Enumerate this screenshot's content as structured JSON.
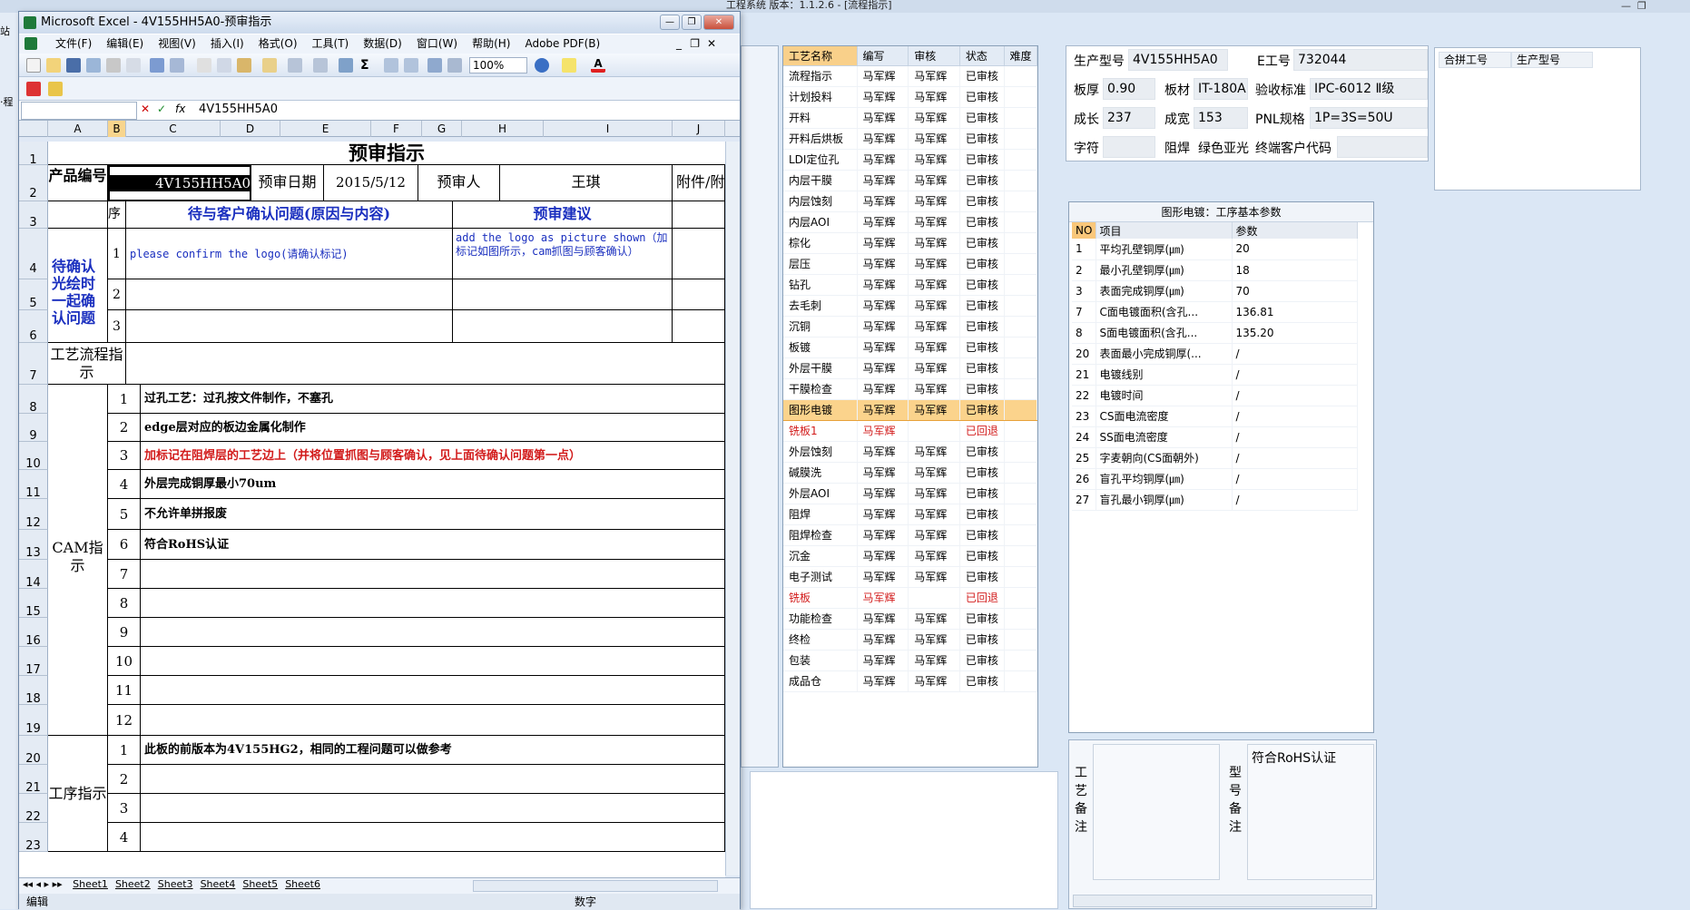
{
  "bg_app": {
    "title": "工程系统  版本：1.1.2.6 - [流程指示]",
    "left_labels": [
      "站",
      "·程"
    ]
  },
  "process_table": {
    "headers": [
      "工艺名称",
      "编写",
      "审核",
      "状态",
      "难度"
    ],
    "rows": [
      [
        "流程指示",
        "马军辉",
        "马军辉",
        "已审核",
        ""
      ],
      [
        "计划投料",
        "马军辉",
        "马军辉",
        "已审核",
        ""
      ],
      [
        "开料",
        "马军辉",
        "马军辉",
        "已审核",
        ""
      ],
      [
        "开料后烘板",
        "马军辉",
        "马军辉",
        "已审核",
        ""
      ],
      [
        "LDI定位孔",
        "马军辉",
        "马军辉",
        "已审核",
        ""
      ],
      [
        "内层干膜",
        "马军辉",
        "马军辉",
        "已审核",
        ""
      ],
      [
        "内层蚀刻",
        "马军辉",
        "马军辉",
        "已审核",
        ""
      ],
      [
        "内层AOI",
        "马军辉",
        "马军辉",
        "已审核",
        ""
      ],
      [
        "棕化",
        "马军辉",
        "马军辉",
        "已审核",
        ""
      ],
      [
        "层压",
        "马军辉",
        "马军辉",
        "已审核",
        ""
      ],
      [
        "钻孔",
        "马军辉",
        "马军辉",
        "已审核",
        ""
      ],
      [
        "去毛刺",
        "马军辉",
        "马军辉",
        "已审核",
        ""
      ],
      [
        "沉铜",
        "马军辉",
        "马军辉",
        "已审核",
        ""
      ],
      [
        "板镀",
        "马军辉",
        "马军辉",
        "已审核",
        ""
      ],
      [
        "外层干膜",
        "马军辉",
        "马军辉",
        "已审核",
        ""
      ],
      [
        "干膜检查",
        "马军辉",
        "马军辉",
        "已审核",
        ""
      ],
      [
        "图形电镀",
        "马军辉",
        "马军辉",
        "已审核",
        ""
      ],
      [
        "铣板1",
        "马军辉",
        "",
        "已回退",
        ""
      ],
      [
        "外层蚀刻",
        "马军辉",
        "马军辉",
        "已审核",
        ""
      ],
      [
        "碱膜洗",
        "马军辉",
        "马军辉",
        "已审核",
        ""
      ],
      [
        "外层AOI",
        "马军辉",
        "马军辉",
        "已审核",
        ""
      ],
      [
        "阻焊",
        "马军辉",
        "马军辉",
        "已审核",
        ""
      ],
      [
        "阻焊检查",
        "马军辉",
        "马军辉",
        "已审核",
        ""
      ],
      [
        "沉金",
        "马军辉",
        "马军辉",
        "已审核",
        ""
      ],
      [
        "电子测试",
        "马军辉",
        "马军辉",
        "已审核",
        ""
      ],
      [
        "铣板",
        "马军辉",
        "",
        "已回退",
        ""
      ],
      [
        "功能检查",
        "马军辉",
        "马军辉",
        "已审核",
        ""
      ],
      [
        "终检",
        "马军辉",
        "马军辉",
        "已审核",
        ""
      ],
      [
        "包装",
        "马军辉",
        "马军辉",
        "已审核",
        ""
      ],
      [
        "成品仓",
        "马军辉",
        "马军辉",
        "已审核",
        ""
      ]
    ],
    "selected_index": 16,
    "rejected_indices": [
      17,
      25
    ]
  },
  "info": {
    "product_no_label": "生产型号",
    "product_no": "4V155HH5A0",
    "e_no_label": "E工号",
    "e_no": "732044",
    "thickness_label": "板厚",
    "thickness": "0.90",
    "material_label": "板材",
    "material": "IT-180A",
    "standard_label": "验收标准",
    "standard": "IPC-6012 Ⅱ级",
    "length_label": "成长",
    "length": "237",
    "width_label": "成宽",
    "width": "153",
    "pnl_label": "PNL规格",
    "pnl": "1P=3S=50U",
    "char_label": "字符",
    "char": "",
    "mask_label": "阻焊",
    "mask": "绿色亚光",
    "customer_label": "终端客户代码",
    "customer": ""
  },
  "merge": {
    "col1": "合拼工号",
    "col2": "生产型号"
  },
  "params": {
    "title": "图形电镀：工序基本参数",
    "headers": [
      "NO",
      "项目",
      "参数"
    ],
    "rows": [
      [
        "1",
        "平均孔壁铜厚(㎛)",
        "20"
      ],
      [
        "2",
        "最小孔壁铜厚(㎛)",
        "18"
      ],
      [
        "3",
        "表面完成铜厚(㎛)",
        "70"
      ],
      [
        "7",
        "C面电镀面积(含孔...",
        "136.81"
      ],
      [
        "8",
        "S面电镀面积(含孔...",
        "135.20"
      ],
      [
        "20",
        "表面最小完成铜厚(...",
        "/"
      ],
      [
        "21",
        "电镀线别",
        "/"
      ],
      [
        "22",
        "电镀时间",
        "/"
      ],
      [
        "23",
        "CS面电流密度",
        "/"
      ],
      [
        "24",
        "SS面电流密度",
        "/"
      ],
      [
        "25",
        "字麦朝向(CS面朝外)",
        "/"
      ],
      [
        "26",
        "盲孔平均铜厚(㎛)",
        "/"
      ],
      [
        "27",
        "盲孔最小铜厚(㎛)",
        "/"
      ]
    ]
  },
  "notes": {
    "process_label": "工艺备注",
    "model_label": "型号备注",
    "model_note": "符合RoHS认证"
  },
  "excel": {
    "title": "Microsoft Excel - 4V155HH5A0-预审指示",
    "menus": [
      "文件(F)",
      "编辑(E)",
      "视图(V)",
      "插入(I)",
      "格式(O)",
      "工具(T)",
      "数据(D)",
      "窗口(W)",
      "帮助(H)",
      "Adobe PDF(B)"
    ],
    "zoom": "100%",
    "formula": "4V155HH5A0",
    "columns": [
      "A",
      "B",
      "C",
      "D",
      "E",
      "F",
      "G",
      "H",
      "I",
      "J"
    ],
    "row_numbers": [
      "1",
      "2",
      "3",
      "4",
      "5",
      "6",
      "7",
      "8",
      "9",
      "10",
      "11",
      "12",
      "13",
      "14",
      "15",
      "16",
      "17",
      "18",
      "19",
      "20",
      "21",
      "22",
      "23"
    ],
    "sheet": {
      "title": "预审指示",
      "product_label": "产品编号",
      "product_value": "4V155HH5A0",
      "review_date_label": "预审日期",
      "review_date": "2015/5/12",
      "reviewer_label": "预审人",
      "reviewer": "王琪",
      "attach_label": "附件/附图",
      "seq_label": "序号",
      "issue_header": "待与客户确认问题(原因与内容)",
      "suggest_header": "预审建议",
      "confirm_label": "待确认光绘时一起确认问题",
      "issue1": "please confirm the logo(请确认标记)",
      "suggest1": "add the logo as picture shown（加标记如图所示，cam抓图与顾客确认）",
      "flow_label": "工艺流程指示",
      "cam_label": "CAM指示",
      "proc_label": "工序指示",
      "cam_items": [
        "过孔工艺：过孔按文件制作，不塞孔",
        "edge层对应的板边金属化制作",
        "加标记在阻焊层的工艺边上（并将位置抓图与顾客确认，见上面待确认问题第一点）",
        "外层完成铜厚最小70um",
        "不允许单拼报废",
        "符合RoHS认证",
        "",
        "",
        "",
        "",
        "",
        ""
      ],
      "proc_items": [
        "此板的前版本为4V155HG2，相同的工程问题可以做参考",
        "",
        "",
        ""
      ]
    },
    "tabs": [
      "Sheet1",
      "Sheet2",
      "Sheet3",
      "Sheet4",
      "Sheet5",
      "Sheet6"
    ],
    "status_left": "编辑",
    "status_mid": "数字"
  }
}
